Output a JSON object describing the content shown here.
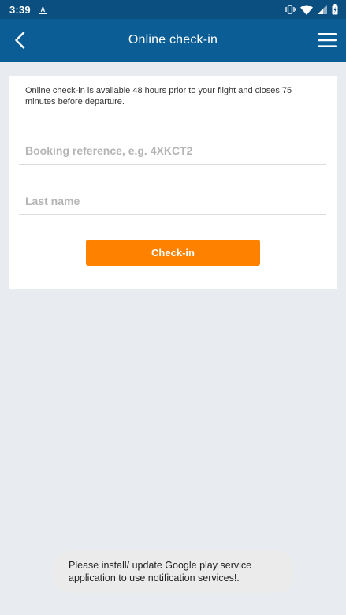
{
  "status_bar": {
    "time": "3:39",
    "notification_icon": "a-icon",
    "icons": [
      "vibrate-icon",
      "wifi-icon",
      "signal-icon",
      "battery-icon"
    ]
  },
  "app_bar": {
    "title": "Online check-in",
    "back_icon": "chevron-left-icon",
    "menu_icon": "hamburger-menu-icon"
  },
  "form": {
    "info": "Online check-in is available 48 hours prior to your flight and closes 75 minutes before departure.",
    "booking_reference": {
      "value": "",
      "placeholder": "Booking reference, e.g. 4XKCT2"
    },
    "last_name": {
      "value": "",
      "placeholder": "Last name"
    },
    "submit_label": "Check-in"
  },
  "toast": {
    "message": "Please install/ update Google play service application to use notification services!."
  },
  "colors": {
    "status_bar": "#0a4f80",
    "app_bar": "#0a5d95",
    "background": "#e8ecf0",
    "accent_button": "#ff8100"
  }
}
